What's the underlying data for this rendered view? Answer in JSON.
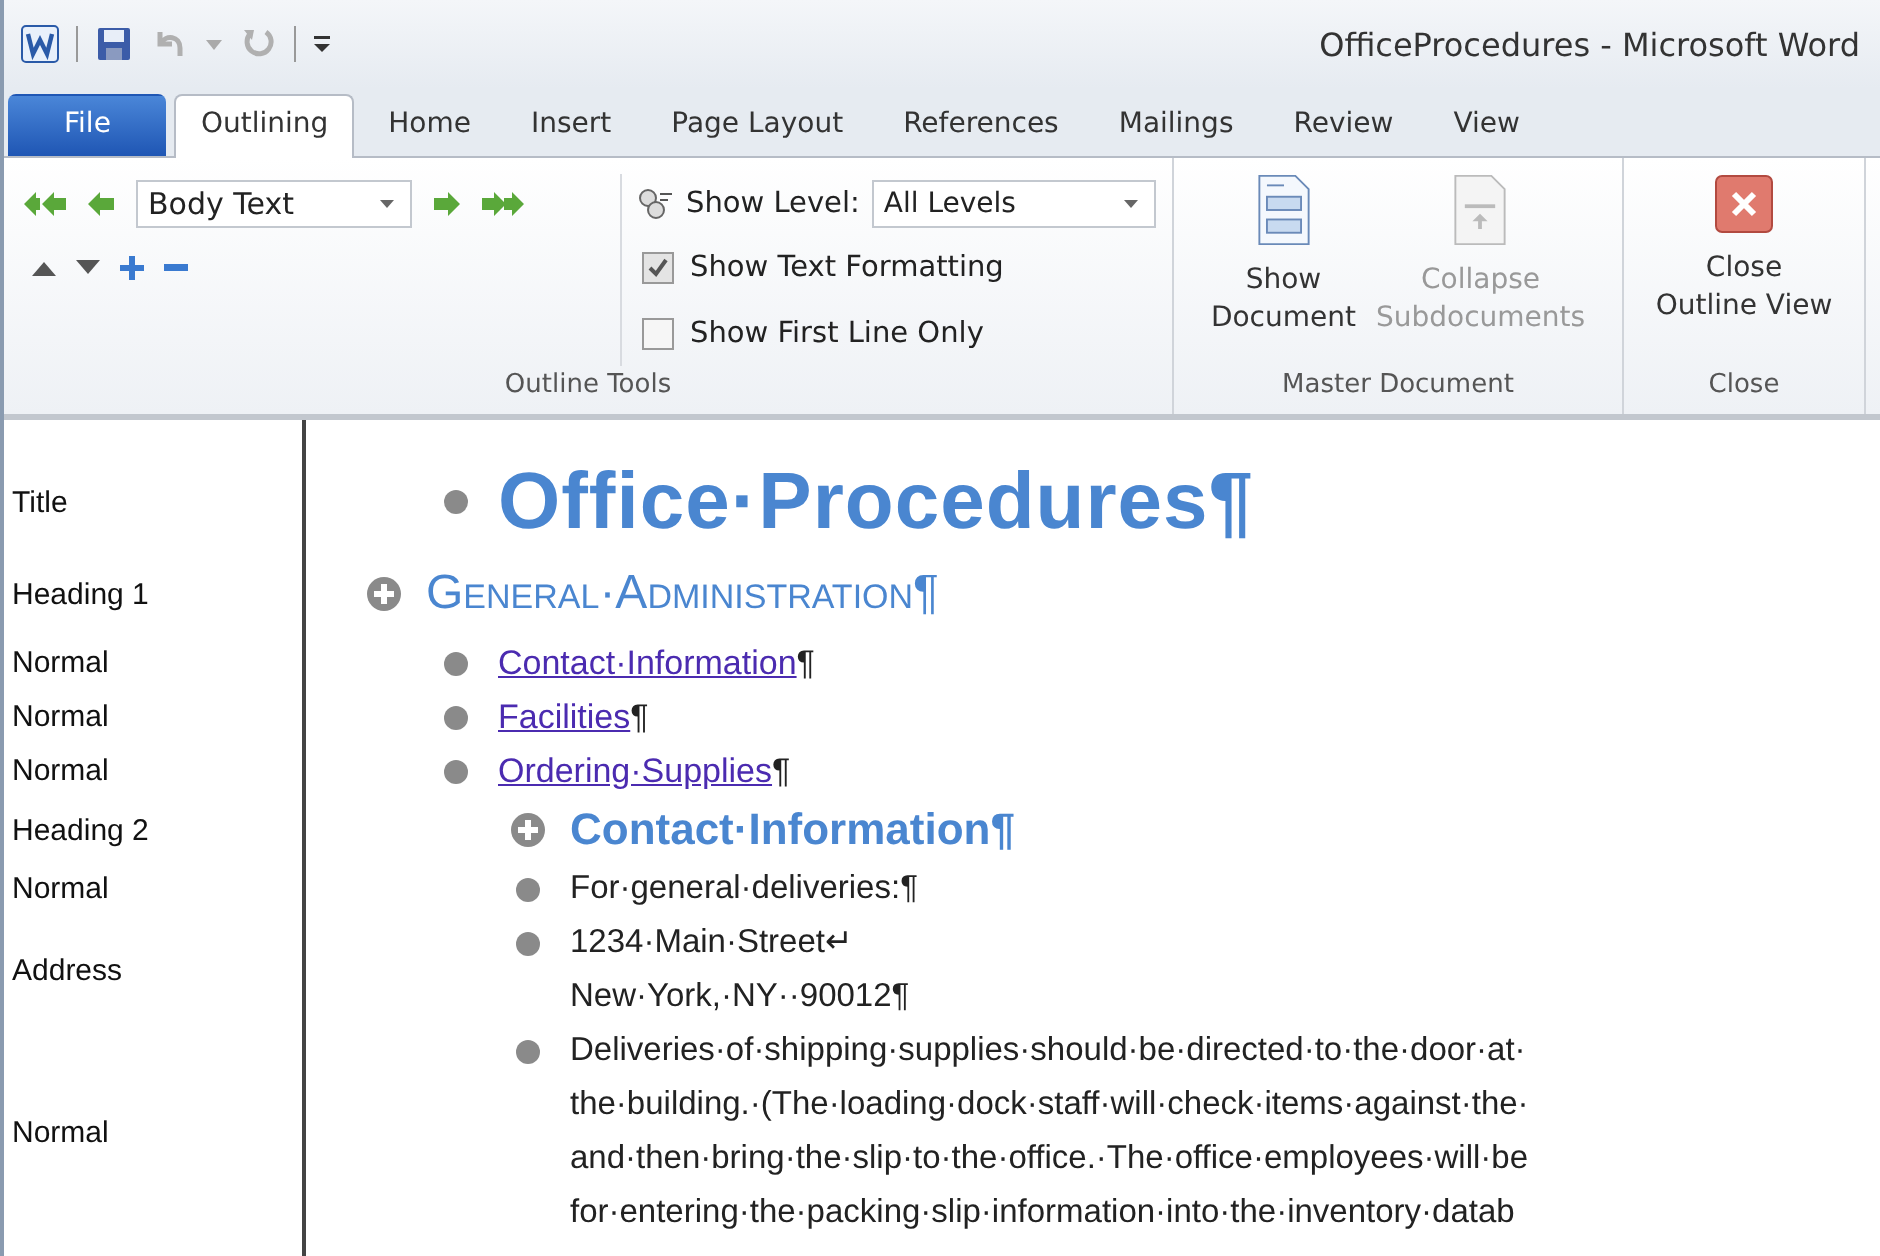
{
  "window": {
    "title": "OfficeProcedures - Microsoft Word"
  },
  "tabs": [
    {
      "label": "File",
      "kind": "file",
      "selected": false
    },
    {
      "label": "Outlining",
      "kind": "tab",
      "selected": true
    },
    {
      "label": "Home",
      "kind": "tab",
      "selected": false
    },
    {
      "label": "Insert",
      "kind": "tab",
      "selected": false
    },
    {
      "label": "Page Layout",
      "kind": "tab",
      "selected": false
    },
    {
      "label": "References",
      "kind": "tab",
      "selected": false
    },
    {
      "label": "Mailings",
      "kind": "tab",
      "selected": false
    },
    {
      "label": "Review",
      "kind": "tab",
      "selected": false
    },
    {
      "label": "View",
      "kind": "tab",
      "selected": false
    }
  ],
  "ribbon": {
    "outline_tools": {
      "level": "Body Text",
      "show_level_label": "Show Level:",
      "show_level": "All Levels",
      "checkboxes": [
        {
          "label": "Show Text Formatting",
          "checked": true
        },
        {
          "label": "Show First Line Only",
          "checked": false
        }
      ],
      "group_label": "Outline Tools"
    },
    "master_document": {
      "buttons": [
        {
          "label": "Show\nDocument",
          "kind": "show",
          "disabled": false
        },
        {
          "label": "Collapse\nSubdocuments",
          "kind": "collapse",
          "disabled": true
        }
      ],
      "group_label": "Master Document"
    },
    "close": {
      "button": "Close\nOutline View",
      "group_label": "Close"
    }
  },
  "outline": [
    {
      "kind": "title",
      "style": "Title",
      "expandable": false,
      "text": "Office·Procedures¶"
    },
    {
      "kind": "heading1",
      "style": "Heading 1",
      "expandable": true,
      "text": "General·Administration¶",
      "children": [
        {
          "kind": "link",
          "style": "Normal",
          "expandable": false,
          "text": "Contact·Information",
          "mark": "¶"
        },
        {
          "kind": "link",
          "style": "Normal",
          "expandable": false,
          "text": "Facilities",
          "mark": "¶"
        },
        {
          "kind": "link",
          "style": "Normal",
          "expandable": false,
          "text": "Ordering·Supplies",
          "mark": "¶"
        },
        {
          "kind": "heading2",
          "style": "Heading 2",
          "expandable": true,
          "text": "Contact·Information¶",
          "children": [
            {
              "kind": "body",
              "style": "Normal",
              "expandable": false,
              "text": "For·general·deliveries:¶"
            },
            {
              "kind": "body",
              "style": "Address",
              "expandable": false,
              "text": "1234·Main·Street↵\nNew·York,·NY··90012¶"
            },
            {
              "kind": "body",
              "style": "Normal",
              "expandable": false,
              "text": "Deliveries·of·shipping·supplies·should·be·directed·to·the·door·at·\nthe·building.·(The·loading·dock·staff·will·check·items·against·the·\nand·then·bring·the·slip·to·the·office.·The·office·employees·will·be\nfor·entering·the·packing·slip·information·into·the·inventory·datab"
            }
          ]
        }
      ]
    }
  ]
}
